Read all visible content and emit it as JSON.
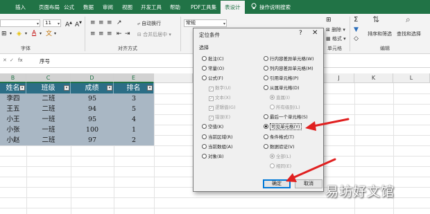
{
  "ribbon": {
    "tabs": [
      "插入",
      "页面布局",
      "公式",
      "数据",
      "审阅",
      "视图",
      "开发工具",
      "帮助",
      "PDF工具集",
      "表设计",
      "操作说明搜索"
    ],
    "font_size": "11",
    "number_format": "常规",
    "wrap_text": "自动换行",
    "merge_center": "合并后居中",
    "groups": {
      "font": "字体",
      "alignment": "对齐方式",
      "cells": "单元格",
      "editing": "编辑"
    },
    "delete": "删除",
    "format": "格式",
    "sort_filter": "排序和筛选",
    "find_select": "查找和选择"
  },
  "formula_bar": {
    "fx": "fx",
    "value": "序号"
  },
  "sheet": {
    "columns": [
      "B",
      "C",
      "D",
      "E",
      "J",
      "K",
      "L"
    ],
    "headers": [
      "姓名",
      "班级",
      "成绩",
      "排名"
    ],
    "rows": [
      [
        "李四",
        "二班",
        "95",
        "3"
      ],
      [
        "王五",
        "二班",
        "94",
        "5"
      ],
      [
        "小王",
        "一班",
        "95",
        "4"
      ],
      [
        "小张",
        "一班",
        "100",
        "1"
      ],
      [
        "小赵",
        "二班",
        "97",
        "2"
      ]
    ]
  },
  "dialog": {
    "title": "定位条件",
    "help": "?",
    "close": "✕",
    "section": "选择",
    "left_options": [
      "批注(C)",
      "常量(O)",
      "公式(F)",
      "数字(U)",
      "文本(X)",
      "逻辑值(G)",
      "错误(E)",
      "空值(K)",
      "当前区域(R)",
      "当前数组(A)",
      "对象(B)"
    ],
    "right_options": [
      "行内容差异单元格(W)",
      "列内容差异单元格(M)",
      "引用单元格(P)",
      "从属单元格(D)",
      "直属(I)",
      "所有级别(L)",
      "最后一个单元格(S)",
      "可见单元格(Y)",
      "条件格式(T)",
      "数据验证(V)",
      "全部(L)",
      "相同(E)"
    ],
    "selected": "可见单元格(Y)",
    "ok": "确定",
    "cancel": "取消"
  },
  "watermark": "易坊好文馆",
  "colors": {
    "excel_green": "#217346",
    "table_header": "#2c6e86",
    "selection": "#a9b7c4",
    "arrow": "#e02020"
  }
}
